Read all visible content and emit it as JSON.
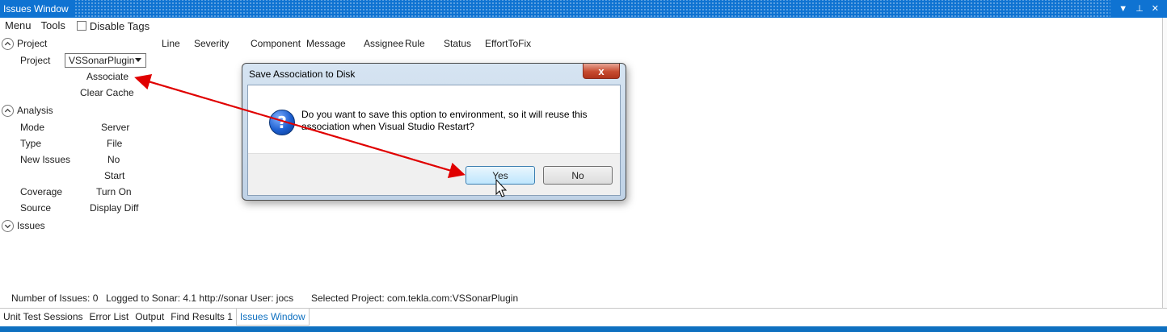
{
  "window": {
    "title": "Issues Window",
    "buttons": [
      "▼",
      "⊥",
      "✕"
    ]
  },
  "menu": {
    "items": [
      "Menu",
      "Tools"
    ],
    "disable_tags_label": "Disable Tags",
    "disable_tags_checked": false
  },
  "columns": [
    "Line",
    "Severity",
    "Component",
    "Message",
    "Assignee",
    "Rule",
    "Status",
    "EffortToFix"
  ],
  "project_section": {
    "header": "Project",
    "project_label": "Project",
    "project_value": "VSSonarPlugin",
    "associate_label": "Associate",
    "clear_cache_label": "Clear Cache"
  },
  "analysis_section": {
    "header": "Analysis",
    "mode_label": "Mode",
    "mode_value": "Server",
    "type_label": "Type",
    "type_value": "File",
    "new_issues_label": "New Issues",
    "new_issues_value": "No",
    "start_label": "Start",
    "coverage_label": "Coverage",
    "coverage_value": "Turn On",
    "source_label": "Source",
    "source_value": "Display Diff"
  },
  "issues_section": {
    "header": "Issues"
  },
  "dialog": {
    "title": "Save Association to Disk",
    "close_symbol": "x",
    "message": "Do you want to save this option to environment, so it will reuse this association when Visual Studio Restart?",
    "yes_label": "Yes",
    "no_label": "No",
    "icon_glyph": "?"
  },
  "status": {
    "issues_count": "Number of Issues: 0",
    "logged": "Logged to Sonar: 4.1 http://sonar User: jocs",
    "selected_project": "Selected Project: com.tekla.com:VSSonarPlugin"
  },
  "tabs": [
    {
      "label": "Unit Test Sessions",
      "active": false
    },
    {
      "label": "Error List",
      "active": false
    },
    {
      "label": "Output",
      "active": false
    },
    {
      "label": "Find Results 1",
      "active": false
    },
    {
      "label": "Issues Window",
      "active": true
    }
  ],
  "colors": {
    "accent": "#0e70c0",
    "arrow": "#e00000"
  }
}
